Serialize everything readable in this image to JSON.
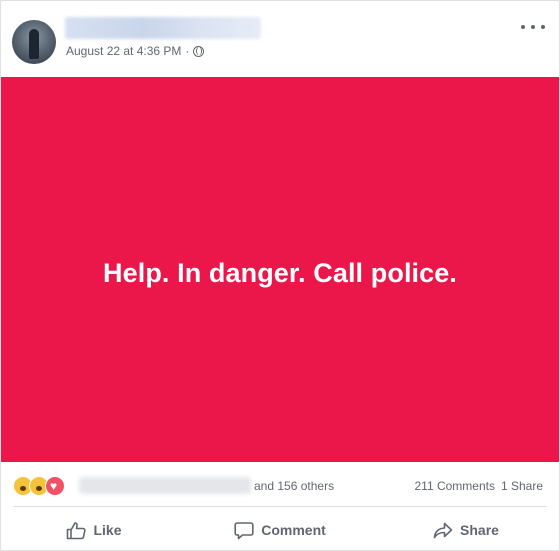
{
  "post": {
    "timestamp": "August 22 at 4:36 PM",
    "separator": "·",
    "image_text": "Help. In danger. Call police.",
    "image_color": "#eb1649"
  },
  "header": {
    "privacy_icon": "globe-icon",
    "more_icon": "more-options-icon"
  },
  "reactions": {
    "icons": [
      "sad-reaction-icon",
      "wow-reaction-icon",
      "love-reaction-icon"
    ],
    "others_text": "and 156 others",
    "comments_text": "211 Comments",
    "shares_text": "1 Share"
  },
  "actions": {
    "like_label": "Like",
    "comment_label": "Comment",
    "share_label": "Share",
    "like_icon": "thumbs-up-icon",
    "comment_icon": "comment-icon",
    "share_icon": "share-arrow-icon"
  }
}
